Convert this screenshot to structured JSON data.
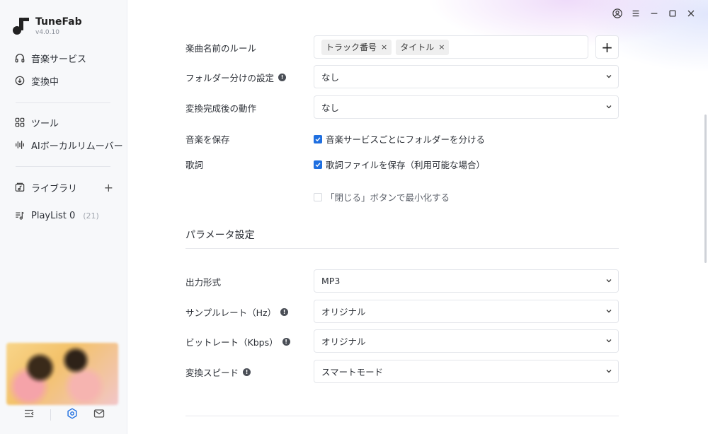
{
  "app": {
    "name": "TuneFab",
    "version": "v4.0.10"
  },
  "sidebar": {
    "items": [
      {
        "label": "音楽サービス",
        "icon": "headphones-icon"
      },
      {
        "label": "変換中",
        "icon": "download-circle-icon"
      },
      {
        "label": "ツール",
        "icon": "grid-icon"
      },
      {
        "label": "AIボーカルリムーバー",
        "icon": "waveform-icon"
      },
      {
        "label": "ライブラリ",
        "icon": "music-folder-icon",
        "action": "+"
      },
      {
        "label": "PlayList 0",
        "icon": "playlist-icon",
        "count": "(21)"
      }
    ]
  },
  "settings": {
    "filename_rule": {
      "label": "楽曲名前のルール",
      "tags": [
        "トラック番号",
        "タイトル"
      ],
      "tag_remove": "×",
      "add": "+"
    },
    "folder_split": {
      "label": "フォルダー分けの設定",
      "value": "なし"
    },
    "after_convert": {
      "label": "変換完成後の動作",
      "value": "なし"
    },
    "save_music": {
      "label": "音楽を保存",
      "option": "音楽サービスごとにフォルダーを分ける",
      "checked": true
    },
    "lyrics": {
      "label": "歌詞",
      "option": "歌詞ファイルを保存（利用可能な場合）",
      "checked": true
    },
    "minimize": {
      "option": "「閉じる」ボタンで最小化する",
      "checked": false
    }
  },
  "parameters": {
    "title": "パラメータ設定",
    "format": {
      "label": "出力形式",
      "value": "MP3"
    },
    "sample_rate": {
      "label": "サンプルレート（Hz）",
      "value": "オリジナル"
    },
    "bitrate": {
      "label": "ビットレート（Kbps）",
      "value": "オリジナル"
    },
    "speed": {
      "label": "変換スピード",
      "value": "スマートモード"
    }
  },
  "info_glyph": "!",
  "colors": {
    "accent": "#1f6fe0"
  }
}
